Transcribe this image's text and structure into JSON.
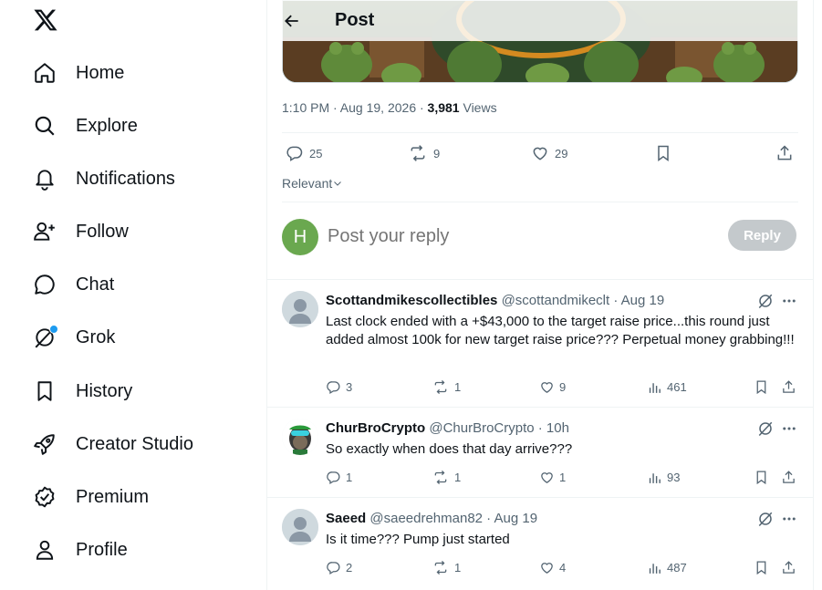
{
  "sidebar": {
    "logo": "x-logo",
    "items": [
      {
        "label": "Home",
        "icon": "home-icon"
      },
      {
        "label": "Explore",
        "icon": "search-icon"
      },
      {
        "label": "Notifications",
        "icon": "bell-icon"
      },
      {
        "label": "Follow",
        "icon": "person-plus-icon"
      },
      {
        "label": "Chat",
        "icon": "chat-icon"
      },
      {
        "label": "Grok",
        "icon": "grok-icon"
      },
      {
        "label": "History",
        "icon": "bookmark-icon"
      },
      {
        "label": "Creator Studio",
        "icon": "rocket-icon"
      },
      {
        "label": "Premium",
        "icon": "verified-icon"
      },
      {
        "label": "Profile",
        "icon": "person-icon"
      }
    ]
  },
  "header": {
    "title": "Post"
  },
  "post": {
    "time": "1:10 PM · Aug 19, 2026 · ",
    "views_count": "3,981",
    "views_label": " Views",
    "replies": "25",
    "reposts": "9",
    "likes": "29"
  },
  "sort": {
    "label": "Relevant"
  },
  "composer": {
    "avatar_letter": "H",
    "placeholder": "Post your reply",
    "button": "Reply"
  },
  "replies": [
    {
      "name": "Scottandmikescollectibles",
      "handle": "@scottandmikeclt · Aug 19",
      "text": "Last clock ended with a +$43,000 to the target raise price...this round just added almost 100k for new target raise price??? Perpetual money grabbing!!!",
      "replies": "3",
      "reposts": "1",
      "likes": "9",
      "views": "461"
    },
    {
      "name": "ChurBroCrypto",
      "handle": "@ChurBroCrypto · 10h",
      "text": "So exactly when does that day arrive???",
      "replies": "1",
      "reposts": "1",
      "likes": "1",
      "views": "93"
    },
    {
      "name": "Saeed",
      "handle": "@saeedrehman82 · Aug 19",
      "text": "Is it time??? Pump just started",
      "replies": "2",
      "reposts": "1",
      "likes": "4",
      "views": "487"
    }
  ],
  "colors": {
    "accent": "#1d9bf0",
    "text": "#0f1419",
    "muted": "#536471",
    "avatar_h": "#6aa84f"
  }
}
